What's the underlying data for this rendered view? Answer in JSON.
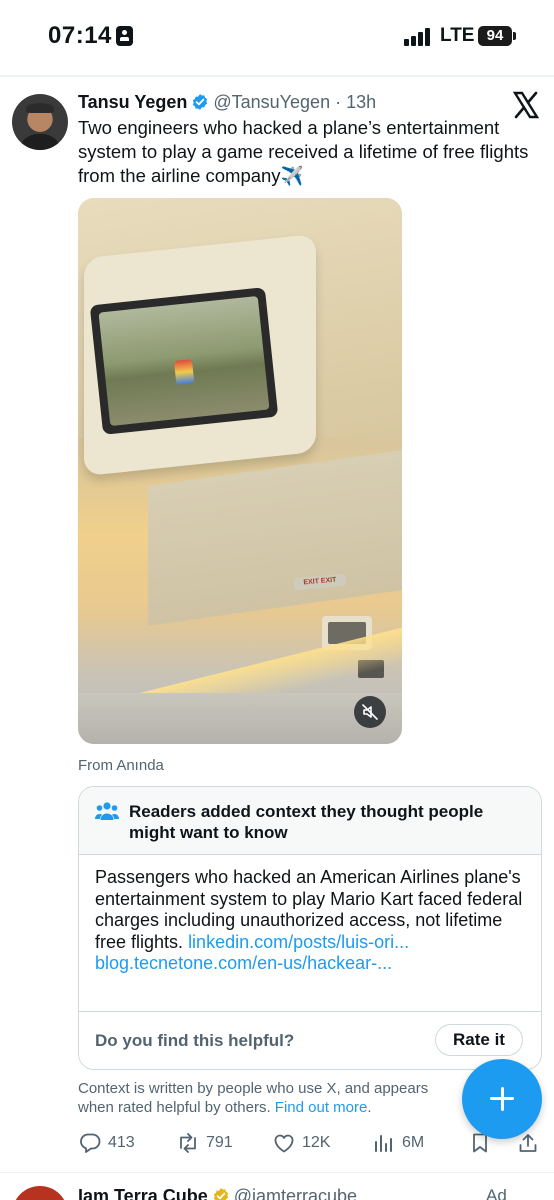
{
  "status_bar": {
    "time": "07:14",
    "network": "LTE",
    "battery": "94"
  },
  "tweet": {
    "author_name": "Tansu Yegen",
    "handle": "@TansuYegen",
    "separator": "·",
    "time_ago": "13h",
    "text": "Two engineers who hacked a plane’s entertainment system to play a game received a lifetime of free flights from the airline company✈️",
    "from_label": "From Anında",
    "media_exit_sign": "EXIT EXIT"
  },
  "community_note": {
    "title": "Readers added context they thought people might want to know",
    "body": "Passengers who hacked an American Airlines plane's entertainment system to play Mario Kart faced federal charges including unauthorized access, not lifetime free flights.",
    "link_1": "linkedin.com/posts/luis-ori...",
    "link_2": "blog.tecnetone.com/en-us/hackear-...",
    "helpful_question": "Do you find this helpful?",
    "rate_button": "Rate it"
  },
  "context_disclaimer": {
    "text": "Context is written by people who use X, and appears when rated helpful by others.",
    "link": "Find out more",
    "trailing": "."
  },
  "actions": {
    "replies": "413",
    "reposts": "791",
    "likes": "12K",
    "views": "6M"
  },
  "next_tweet": {
    "author_name": "Iam Terra Cube",
    "handle": "@iamterracube",
    "ad_label": "Ad"
  },
  "icons": {
    "verified": "verified-badge-icon",
    "x_logo": "x-logo-icon",
    "mute": "muted-speaker-icon",
    "note": "people-icon",
    "reply": "reply-icon",
    "repost": "repost-icon",
    "like": "heart-icon",
    "views": "views-chart-icon",
    "bookmark": "bookmark-icon",
    "share": "share-icon",
    "compose": "plus-icon"
  },
  "colors": {
    "accent": "#1d9bf0",
    "text_primary": "#0f1419",
    "text_secondary": "#536471",
    "border": "#cfd9de"
  }
}
